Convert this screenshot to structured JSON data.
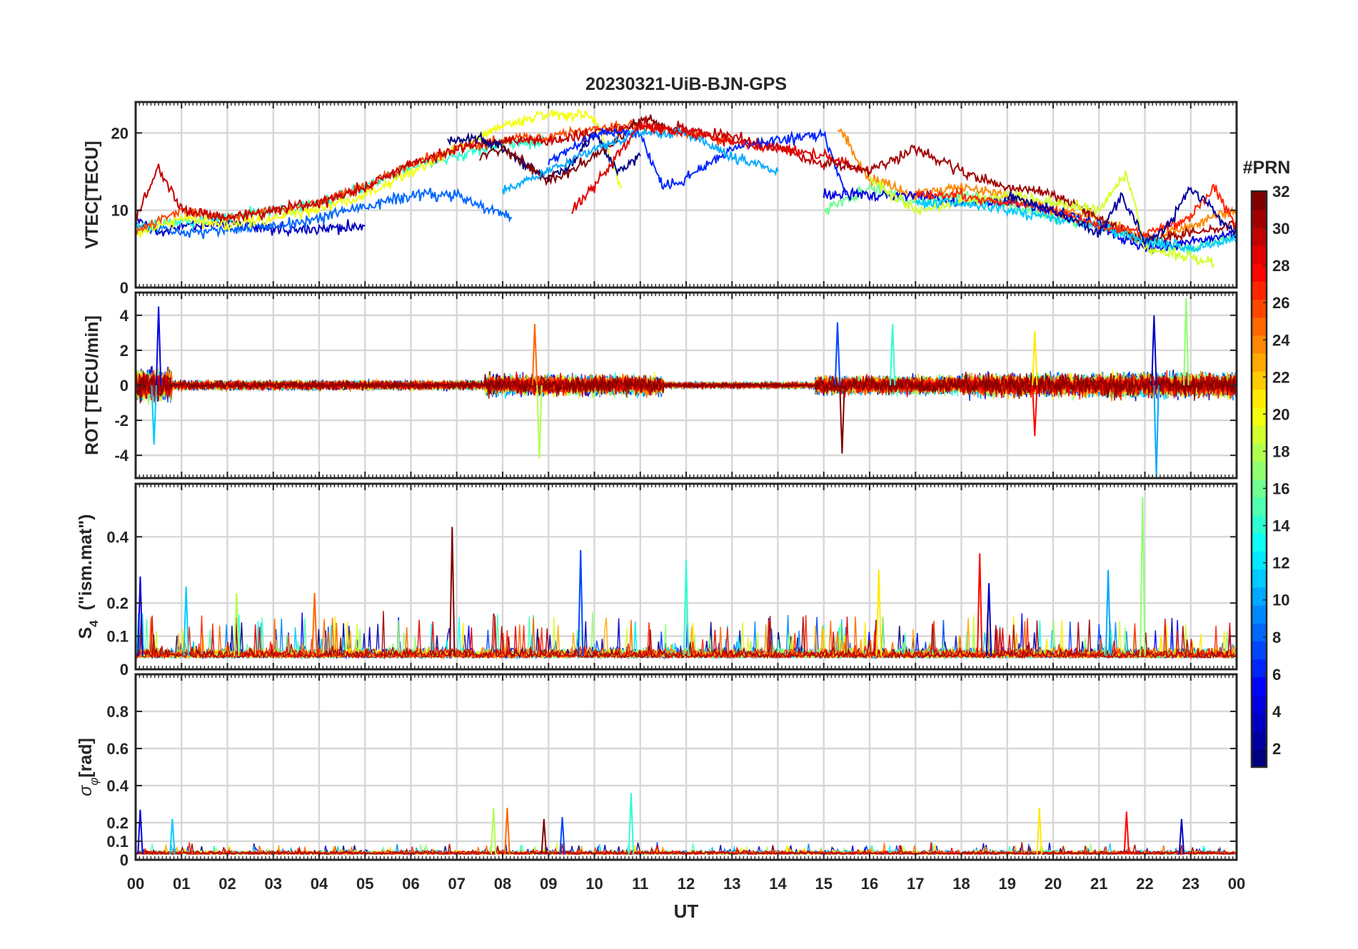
{
  "chart_data": {
    "type": "line",
    "title": "20230321-UiB-BJN-GPS",
    "xlabel": "UT",
    "xlim": [
      0,
      24
    ],
    "x_tick_labels": [
      "00",
      "01",
      "02",
      "03",
      "04",
      "05",
      "06",
      "07",
      "08",
      "09",
      "10",
      "11",
      "12",
      "13",
      "14",
      "15",
      "16",
      "17",
      "18",
      "19",
      "20",
      "21",
      "22",
      "23",
      "00"
    ],
    "grid": true,
    "colorbar": {
      "label": "#PRN",
      "range": [
        1,
        32
      ],
      "tick_labels": [
        "2",
        "4",
        "6",
        "8",
        "10",
        "12",
        "14",
        "16",
        "18",
        "20",
        "22",
        "24",
        "26",
        "28",
        "30",
        "32"
      ],
      "colormap": "jet",
      "placement": "right"
    },
    "panels": [
      {
        "id": "vtec",
        "ylabel": "VTEC[TECU]",
        "ylim": [
          0,
          24
        ],
        "yticks": [
          0,
          10,
          20
        ],
        "series": [
          {
            "prn": 3,
            "x": [
              0,
              0.5,
              1,
              2,
              3,
              4,
              5
            ],
            "y": [
              9,
              7,
              8,
              8.5,
              7.5,
              7.5,
              8
            ]
          },
          {
            "prn": 8,
            "x": [
              0,
              1,
              2,
              3,
              4,
              5,
              6,
              7,
              7.5,
              8.2
            ],
            "y": [
              8,
              7,
              7.5,
              8,
              9,
              10.5,
              12,
              12,
              10.5,
              9
            ]
          },
          {
            "prn": 14,
            "x": [
              0,
              1,
              2,
              3,
              4,
              5,
              6,
              7,
              8,
              9
            ],
            "y": [
              8,
              8.5,
              9,
              10,
              11,
              13,
              15.5,
              17,
              18.5,
              19
            ]
          },
          {
            "prn": 20,
            "x": [
              0,
              1,
              2,
              3,
              4,
              5,
              6,
              7,
              8,
              9,
              10,
              10.6
            ],
            "y": [
              7,
              9,
              8,
              9,
              10,
              12,
              15,
              18,
              21,
              22.5,
              22,
              13
            ]
          },
          {
            "prn": 26,
            "x": [
              0,
              1,
              2,
              3,
              4,
              5,
              6,
              7,
              8,
              9,
              10,
              11,
              12,
              13
            ],
            "y": [
              7,
              10,
              9,
              10,
              11,
              13,
              16,
              18,
              19,
              19.5,
              20.5,
              21,
              20,
              19
            ]
          },
          {
            "prn": 30,
            "x": [
              0,
              0.5,
              1,
              2,
              3,
              4,
              5,
              6,
              7,
              8,
              9,
              10,
              11,
              12,
              13,
              14,
              15
            ],
            "y": [
              9,
              15.5,
              10,
              9,
              10,
              11,
              13,
              16,
              18,
              19,
              19,
              20,
              21,
              20.5,
              19.5,
              18,
              16
            ]
          },
          {
            "prn": 1,
            "x": [
              6.8,
              7.5,
              8,
              8.5,
              9,
              9.5,
              10,
              10.5,
              11
            ],
            "y": [
              19,
              19.5,
              18,
              16,
              14,
              16,
              20,
              15,
              17
            ]
          },
          {
            "prn": 32,
            "x": [
              7.5,
              8,
              8.5,
              9,
              9.5,
              10,
              10.5,
              11,
              11.5
            ],
            "y": [
              17,
              18,
              16,
              14,
              15,
              17,
              19,
              22,
              21
            ]
          },
          {
            "prn": 6,
            "x": [
              9,
              10,
              11,
              11.5,
              12,
              13,
              14,
              15,
              15.5
            ],
            "y": [
              16,
              20,
              20,
              13,
              14,
              18,
              19,
              20,
              12
            ]
          },
          {
            "prn": 10,
            "x": [
              8,
              9,
              10,
              11,
              12,
              13,
              14
            ],
            "y": [
              12.5,
              15,
              18,
              20,
              20,
              17,
              15
            ]
          },
          {
            "prn": 29,
            "x": [
              9.5,
              10,
              10.5,
              11,
              12,
              13,
              14,
              15,
              16
            ],
            "y": [
              10,
              13,
              17,
              21,
              20,
              19,
              18,
              17,
              15
            ]
          },
          {
            "prn": 24,
            "x": [
              15.3,
              16,
              17,
              18,
              19,
              20,
              21,
              22,
              23,
              24
            ],
            "y": [
              21,
              14,
              12,
              13,
              12,
              10,
              9,
              6,
              8,
              10
            ]
          },
          {
            "prn": 16,
            "x": [
              15,
              16,
              17,
              18,
              19,
              20,
              21,
              22,
              23,
              24
            ],
            "y": [
              10,
              13,
              11,
              12,
              11,
              9,
              8,
              6,
              5,
              7
            ]
          },
          {
            "prn": 31,
            "x": [
              15,
              16,
              17,
              18,
              19,
              20,
              21,
              22,
              23,
              24
            ],
            "y": [
              16,
              15,
              18,
              15,
              13,
              12,
              9,
              6,
              7,
              8
            ]
          },
          {
            "prn": 4,
            "x": [
              15,
              16,
              17,
              18,
              19,
              20,
              21,
              22,
              23,
              24
            ],
            "y": [
              12,
              12,
              12,
              11,
              11,
              10,
              8,
              5,
              6,
              7
            ]
          },
          {
            "prn": 19,
            "x": [
              16,
              17,
              18,
              19,
              20,
              21,
              21.6,
              22,
              23,
              23.5
            ],
            "y": [
              14,
              10,
              11,
              12,
              11,
              10,
              15,
              5,
              4,
              3
            ]
          },
          {
            "prn": 11,
            "x": [
              17,
              18,
              19,
              20,
              21,
              22,
              23,
              24
            ],
            "y": [
              11,
              11,
              10,
              9,
              8,
              6,
              5,
              6
            ]
          },
          {
            "prn": 27,
            "x": [
              17,
              18,
              19,
              20,
              21,
              22,
              23,
              23.5,
              24
            ],
            "y": [
              12,
              12,
              11,
              10,
              8,
              7,
              9,
              13,
              8
            ]
          },
          {
            "prn": 2,
            "x": [
              19,
              20,
              21,
              21.5,
              22,
              22.5,
              23,
              24
            ],
            "y": [
              12,
              10,
              7,
              12,
              6,
              8,
              13,
              7
            ]
          }
        ]
      },
      {
        "id": "rot",
        "ylabel": "ROT [TECU/min]",
        "ylim": [
          -5.3,
          5.3
        ],
        "yticks": [
          -4,
          -2,
          0,
          2,
          4
        ],
        "range_note": "values fluctuate around 0, mostly within about ±2 TECU/min; extremes near +4.5 and -5",
        "spikes": [
          {
            "x": 0.5,
            "y": 4.5
          },
          {
            "x": 0.4,
            "y": -3.4
          },
          {
            "x": 8.8,
            "y": -4.2
          },
          {
            "x": 8.7,
            "y": 3.5
          },
          {
            "x": 15.4,
            "y": -3.9
          },
          {
            "x": 15.3,
            "y": 3.6
          },
          {
            "x": 16.5,
            "y": 3.5
          },
          {
            "x": 19.6,
            "y": 3.1
          },
          {
            "x": 19.6,
            "y": -2.9
          },
          {
            "x": 22.2,
            "y": 4.0
          },
          {
            "x": 22.25,
            "y": -5.2
          },
          {
            "x": 22.9,
            "y": 5.0
          }
        ]
      },
      {
        "id": "s4",
        "ylabel": "S4 (\"ism.mat\")",
        "ylabel_main": "S",
        "ylabel_sub": "4",
        "ylabel_rest": "  (\"ism.mat\")",
        "ylim": [
          0,
          0.56
        ],
        "yticks": [
          0,
          0.1,
          0.2,
          0.4
        ],
        "range_note": "baseline about 0.02–0.05 with frequent bursts up to about 0.1–0.2",
        "spikes": [
          {
            "x": 0.1,
            "y": 0.28
          },
          {
            "x": 1.1,
            "y": 0.25
          },
          {
            "x": 2.2,
            "y": 0.23
          },
          {
            "x": 3.9,
            "y": 0.23
          },
          {
            "x": 6.9,
            "y": 0.43
          },
          {
            "x": 9.7,
            "y": 0.36
          },
          {
            "x": 12.0,
            "y": 0.33
          },
          {
            "x": 16.2,
            "y": 0.3
          },
          {
            "x": 18.4,
            "y": 0.35
          },
          {
            "x": 18.6,
            "y": 0.26
          },
          {
            "x": 21.2,
            "y": 0.3
          },
          {
            "x": 21.95,
            "y": 0.52
          }
        ]
      },
      {
        "id": "sigma_phi",
        "ylabel": "σ φ[rad]",
        "ylabel_main": "σ",
        "ylabel_sub": "φ",
        "ylabel_rest": "[rad]",
        "ylim": [
          0,
          1.0
        ],
        "yticks": [
          0,
          0.1,
          0.2,
          0.4,
          0.6,
          0.8
        ],
        "range_note": "mostly below 0.05 with isolated bursts",
        "spikes": [
          {
            "x": 0.1,
            "y": 0.27
          },
          {
            "x": 0.8,
            "y": 0.22
          },
          {
            "x": 7.8,
            "y": 0.28
          },
          {
            "x": 8.1,
            "y": 0.28
          },
          {
            "x": 8.9,
            "y": 0.22
          },
          {
            "x": 9.3,
            "y": 0.23
          },
          {
            "x": 10.8,
            "y": 0.36
          },
          {
            "x": 19.7,
            "y": 0.28
          },
          {
            "x": 21.6,
            "y": 0.26
          },
          {
            "x": 22.8,
            "y": 0.22
          }
        ]
      }
    ]
  }
}
